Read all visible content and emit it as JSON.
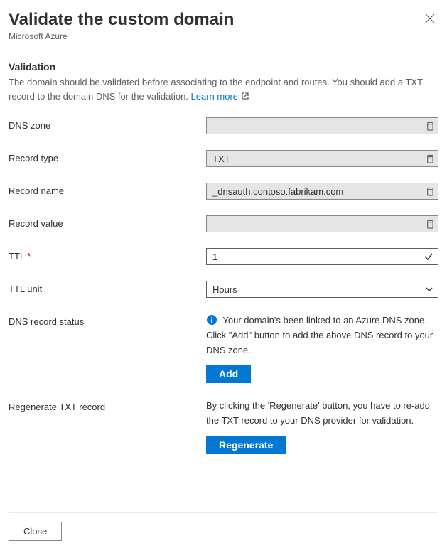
{
  "header": {
    "title": "Validate the custom domain",
    "subtitle": "Microsoft Azure"
  },
  "validation": {
    "heading": "Validation",
    "description_part1": "The domain should be validated before associating to the endpoint and routes. You should add a TXT record to the domain DNS for the validation. ",
    "learn_more": "Learn more"
  },
  "fields": {
    "dns_zone": {
      "label": "DNS zone",
      "value": ""
    },
    "record_type": {
      "label": "Record type",
      "value": "TXT"
    },
    "record_name": {
      "label": "Record name",
      "value": "_dnsauth.contoso.fabrikam.com"
    },
    "record_value": {
      "label": "Record value",
      "value": ""
    },
    "ttl": {
      "label": "TTL",
      "value": "1"
    },
    "ttl_unit": {
      "label": "TTL unit",
      "value": "Hours"
    },
    "dns_status": {
      "label": "DNS record status",
      "message": "Your domain's been linked to an Azure DNS zone. Click \"Add\" button to add the above DNS record to your DNS zone.",
      "button": "Add"
    },
    "regenerate": {
      "label": "Regenerate TXT record",
      "message": "By clicking the 'Regenerate' button, you have to re-add the TXT record to your DNS provider for validation.",
      "button": "Regenerate"
    }
  },
  "footer": {
    "close": "Close"
  }
}
